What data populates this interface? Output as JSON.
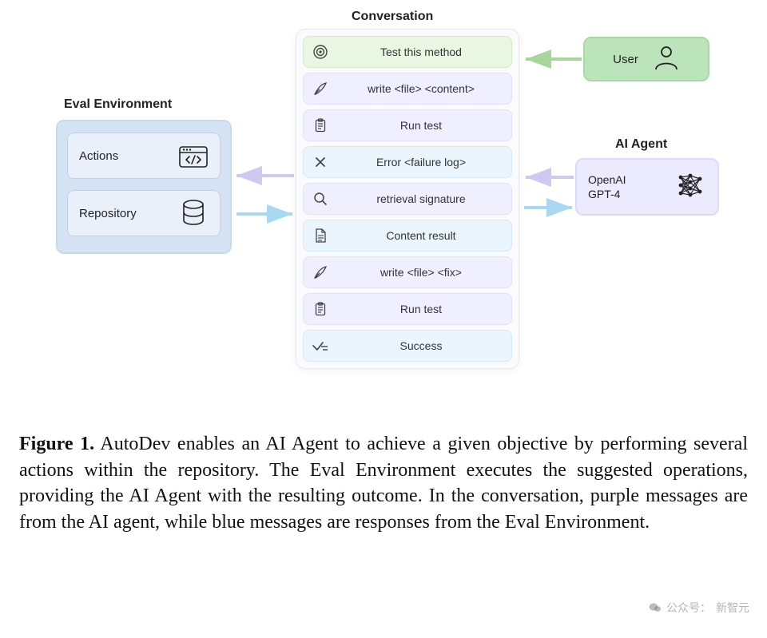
{
  "titles": {
    "eval": "Eval Environment",
    "conversation": "Conversation",
    "agent": "AI Agent"
  },
  "eval": {
    "actions_label": "Actions",
    "repository_label": "Repository"
  },
  "user": {
    "label": "User"
  },
  "agent": {
    "line1": "OpenAI",
    "line2": "GPT-4"
  },
  "conversation": [
    {
      "text": "Test this method",
      "color": "green",
      "icon": "target-icon"
    },
    {
      "text": "write <file> <content>",
      "color": "purple",
      "icon": "quill-icon"
    },
    {
      "text": "Run test",
      "color": "purple",
      "icon": "clipboard-icon"
    },
    {
      "text": "Error <failure log>",
      "color": "blue",
      "icon": "x-icon"
    },
    {
      "text": "retrieval signature",
      "color": "purple",
      "icon": "search-icon"
    },
    {
      "text": "Content result",
      "color": "blue",
      "icon": "document-icon"
    },
    {
      "text": "write <file> <fix>",
      "color": "purple",
      "icon": "quill-icon"
    },
    {
      "text": "Run test",
      "color": "purple",
      "icon": "clipboard-icon"
    },
    {
      "text": "Success",
      "color": "blue",
      "icon": "check-icon"
    }
  ],
  "caption": {
    "label": "Figure 1.",
    "text": " AutoDev enables an AI Agent to achieve a given objective by performing several actions within the repository. The Eval Environment executes the suggested operations, providing the AI Agent with the resulting outcome. In the conversation, purple messages are from the AI agent, while blue messages are responses from the Eval Environment."
  },
  "watermark": {
    "prefix": "公众号：",
    "source": "新智元"
  }
}
